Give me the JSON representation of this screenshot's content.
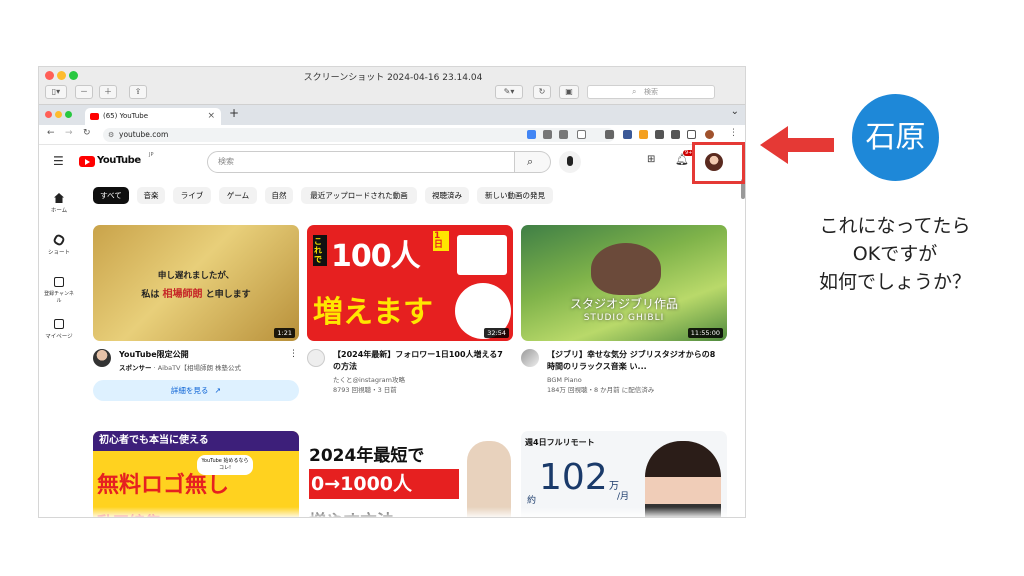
{
  "preview_window": {
    "title": "スクリーンショット 2024-04-16 23.14.04",
    "search_placeholder": "検索"
  },
  "browser": {
    "tab_title": "(65) YouTube",
    "tab_close": "×",
    "new_tab": "+",
    "url": "youtube.com",
    "menu_chevron": "⌄"
  },
  "youtube": {
    "logo": "YouTube",
    "logo_region": "JP",
    "search_placeholder": "検索",
    "notification_count": "9+",
    "sidebar": [
      {
        "label": "ホーム"
      },
      {
        "label": "ショート"
      },
      {
        "label": "登録チャンネル"
      },
      {
        "label": "マイページ"
      }
    ],
    "chips": [
      "すべて",
      "音楽",
      "ライブ",
      "ゲーム",
      "自然",
      "最近アップロードされた動画",
      "視聴済み",
      "新しい動画の発見"
    ],
    "videos": [
      {
        "thumb_line1": "申し遅れましたが、",
        "thumb_line2_pre": "私は",
        "thumb_line2_name": "相場師朗",
        "thumb_line2_post": "と申します",
        "duration": "1:21",
        "title": "YouTube限定公開",
        "sponsor_label": "スポンサー",
        "channel": "AibaTV【相場師朗 株塾公式",
        "cta": "詳細を見る"
      },
      {
        "thumb_top": "これで",
        "thumb_big": "100人",
        "thumb_side": "1日",
        "thumb_bottom": "増えます",
        "duration": "32:54",
        "title": "【2024年最新】フォロワー1日100人増える7の方法",
        "channel": "たくと@instagram攻略",
        "stats": "8793 回視聴・3 日前"
      },
      {
        "thumb_jp": "スタジオジブリ作品",
        "thumb_en": "STUDIO GHIBLI",
        "duration": "11:55:00",
        "title": "【ジブリ】幸せな気分 ジブリスタジオからの8時間のリラックス音楽 い...",
        "channel": "BGM Piano",
        "stats": "184万 回視聴・8 か月前 に配信済み"
      }
    ],
    "row2": [
      {
        "banner": "初心者でも本当に使える",
        "big": "無料ロゴ無し",
        "bubble": "YouTube 始めるならコレ!",
        "tail": "動画編集"
      },
      {
        "line1": "2024年最短で",
        "line2": "0→1000人",
        "line3": "増やす方法"
      },
      {
        "line1": "週4日フルリモート",
        "prefix": "約",
        "number": "102",
        "unit": "万",
        "per": "/月"
      }
    ]
  },
  "annotation": {
    "badge": "石原",
    "note_lines": [
      "これになってたら",
      "OKですが",
      "如何でしょうか？"
    ],
    "arrow_color": "#e53935"
  }
}
